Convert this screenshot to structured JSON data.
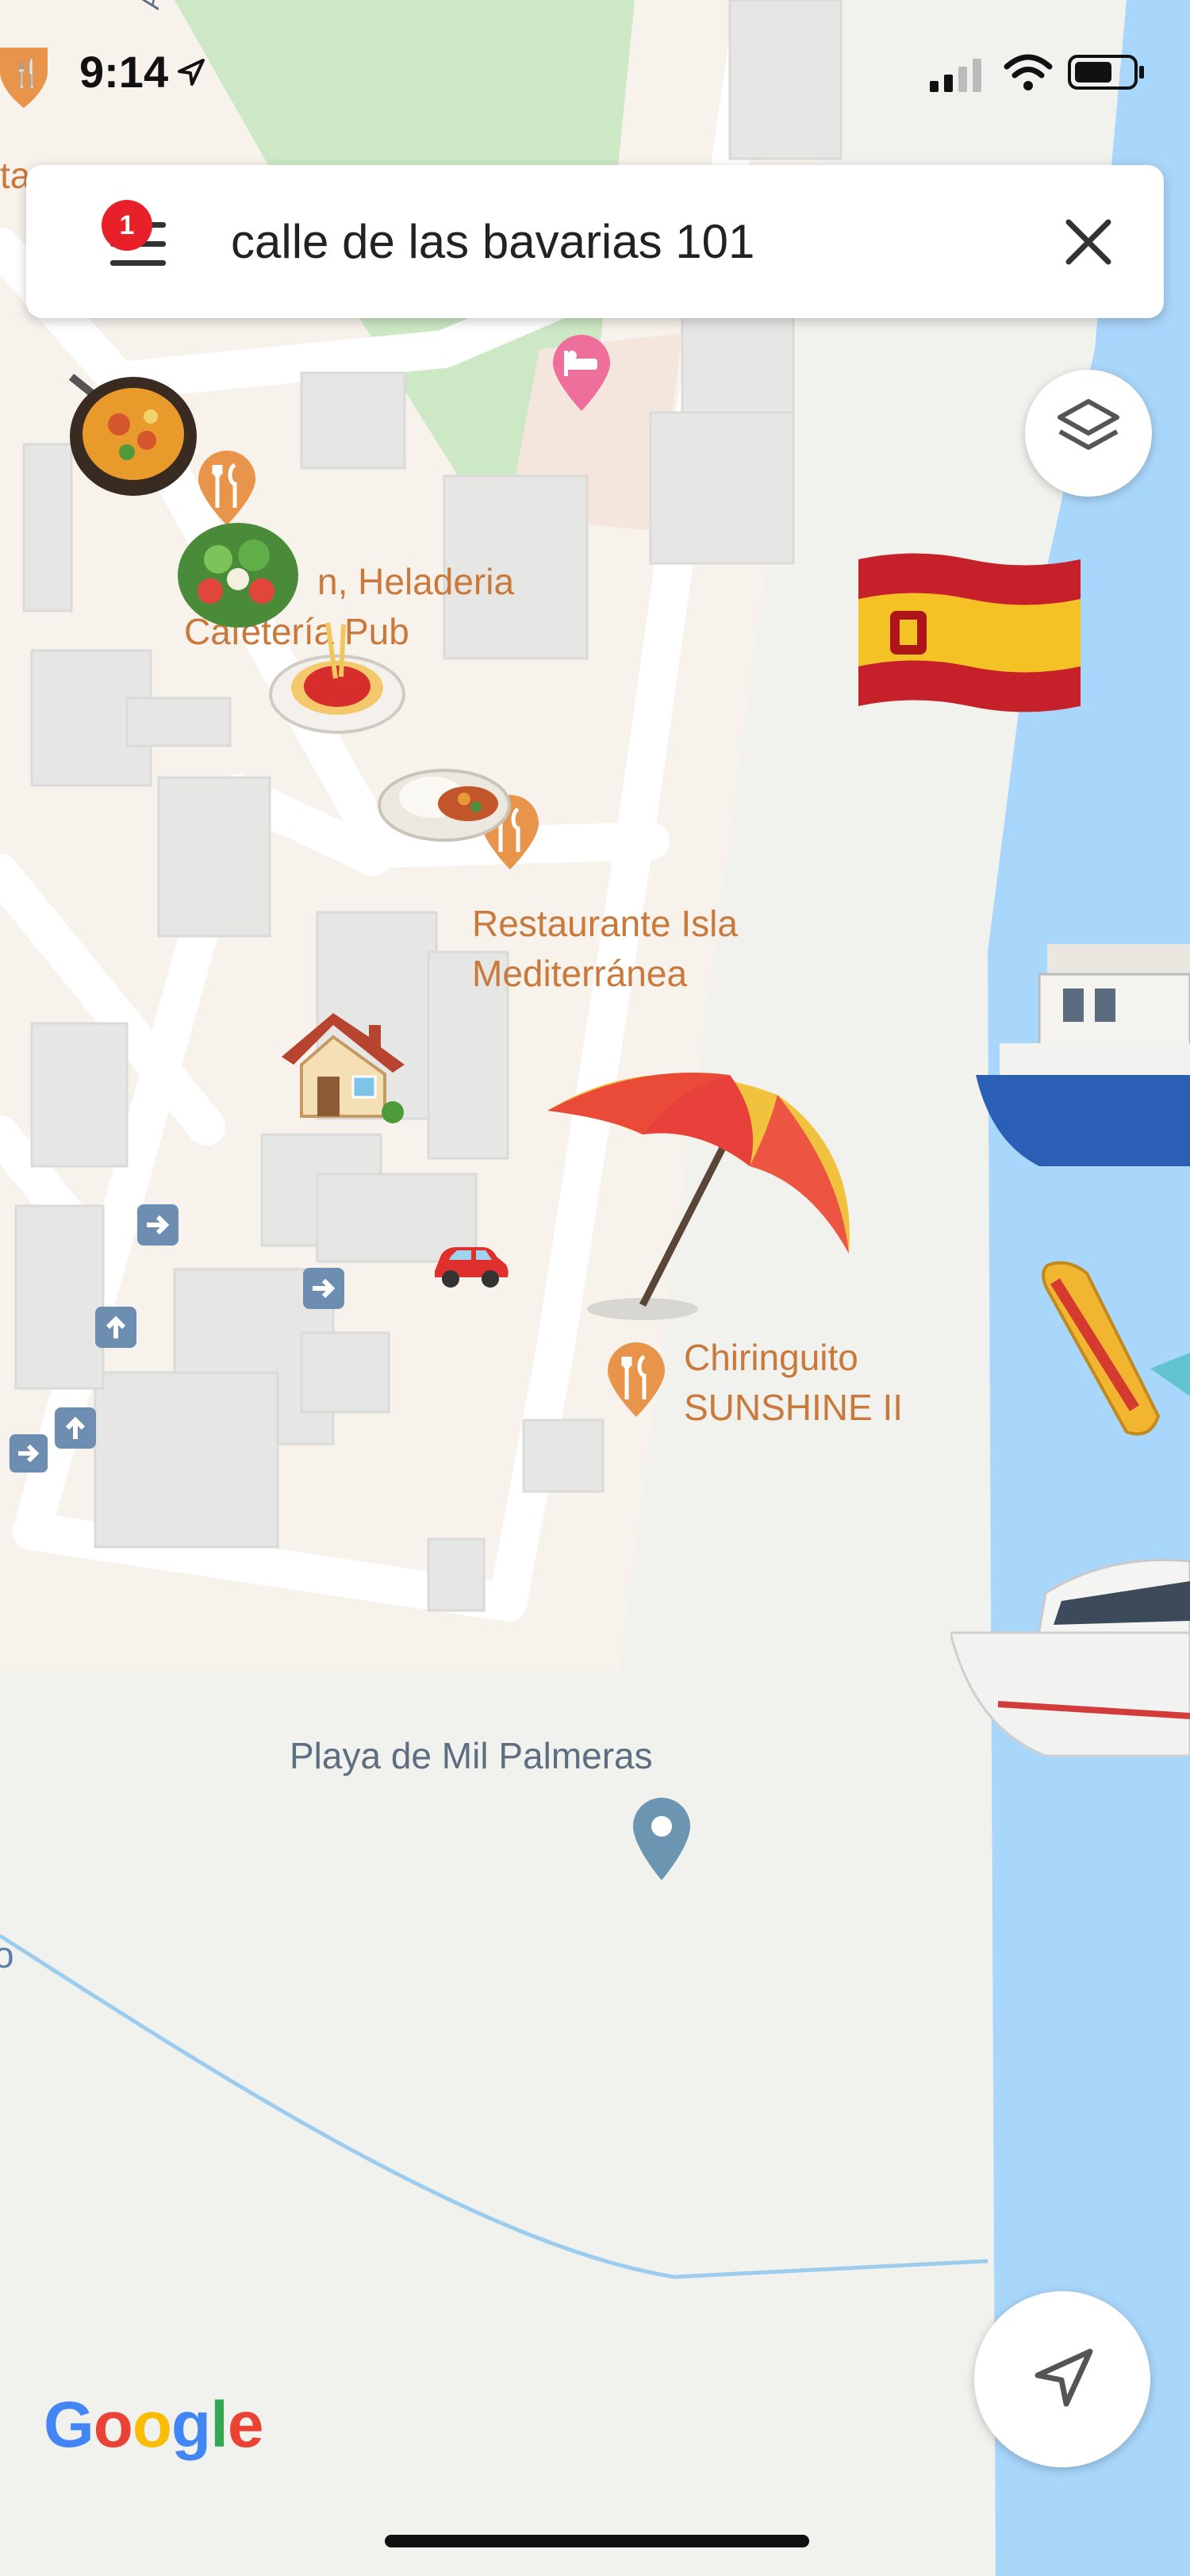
{
  "status_bar": {
    "time": "9:14"
  },
  "search": {
    "query": "calle de las bavarias 101",
    "notification_count": "1"
  },
  "places": {
    "cafe_line1": "n, Heladeria",
    "cafe_line2": "Cafetería Pub",
    "restaurant_line1": "Restaurante Isla",
    "restaurant_line2": "Mediterránea",
    "chiringuito_line1": "Chiringuito",
    "chiringuito_line2": "SUNSHINE II",
    "beach": "Playa de Mil Palmeras",
    "top_left_partial": "ta",
    "road_partial": "Av. c"
  },
  "attribution": {
    "logo": "Google",
    "logo_colors": [
      "#4285F4",
      "#EA4335",
      "#FBBC05",
      "#4285F4",
      "#34A853",
      "#EA4335"
    ]
  },
  "colors": {
    "water": "#a9d6fb",
    "land": "#f1f1ee",
    "block": "#e4e4e2",
    "road": "#ffffff",
    "park": "#cce8c5",
    "poi": "#e8944a"
  },
  "stickers": [
    "paella",
    "salad",
    "spaghetti",
    "curry-rice",
    "house",
    "car",
    "beach-umbrella",
    "spain-flag",
    "ferry",
    "speedboat",
    "motor-boat"
  ],
  "controls": {
    "layers_icon": "layers-icon",
    "locate_icon": "navigation-arrow-icon"
  }
}
